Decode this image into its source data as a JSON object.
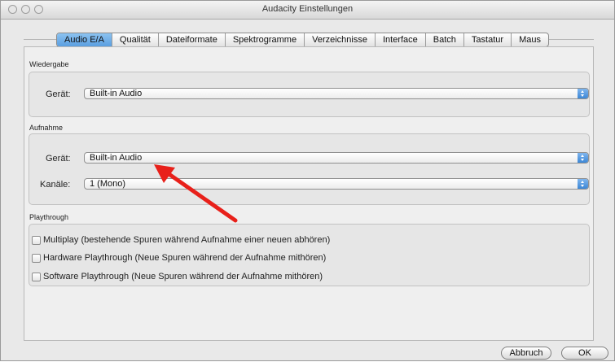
{
  "window": {
    "title": "Audacity Einstellungen"
  },
  "tabs": [
    {
      "label": "Audio E/A",
      "active": true
    },
    {
      "label": "Qualität",
      "active": false
    },
    {
      "label": "Dateiformate",
      "active": false
    },
    {
      "label": "Spektrogramme",
      "active": false
    },
    {
      "label": "Verzeichnisse",
      "active": false
    },
    {
      "label": "Interface",
      "active": false
    },
    {
      "label": "Batch",
      "active": false
    },
    {
      "label": "Tastatur",
      "active": false
    },
    {
      "label": "Maus",
      "active": false
    }
  ],
  "playback": {
    "group_label": "Wiedergabe",
    "device_label": "Gerät:",
    "device_value": "Built-in Audio"
  },
  "recording": {
    "group_label": "Aufnahme",
    "device_label": "Gerät:",
    "device_value": "Built-in Audio",
    "channels_label": "Kanäle:",
    "channels_value": "1 (Mono)"
  },
  "playthrough": {
    "group_label": "Playthrough",
    "options": [
      {
        "label": "Multiplay (bestehende Spuren während Aufnahme einer neuen abhören)",
        "checked": false
      },
      {
        "label": "Hardware Playthrough (Neue Spuren während der Aufnahme mithören)",
        "checked": false
      },
      {
        "label": "Software Playthrough (Neue Spuren während der Aufnahme mithören)",
        "checked": false
      }
    ]
  },
  "buttons": {
    "cancel": "Abbruch",
    "ok": "OK"
  },
  "annotation": {
    "arrow_color": "#e8201a"
  },
  "colors": {
    "accent": "#5a9ee0"
  }
}
